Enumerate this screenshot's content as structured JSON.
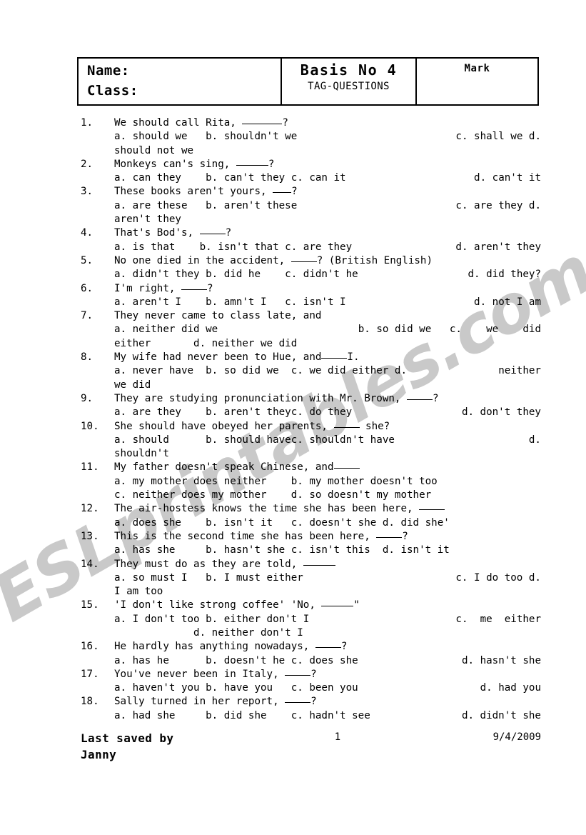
{
  "header": {
    "name_label": "Name:",
    "class_label": "Class:",
    "title": "Basis No 4",
    "subtitle": "TAG-QUESTIONS",
    "mark_label": "Mark"
  },
  "watermark": {
    "text": "ESLprintables.com"
  },
  "questions": [
    {
      "num": "1.",
      "lines": [
        {
          "type": "stem",
          "segments": [
            {
              "t": "text",
              "v": "We should call Rita, "
            },
            {
              "t": "blank",
              "w": "w6"
            },
            {
              "t": "text",
              "v": "?"
            }
          ]
        },
        {
          "type": "options",
          "segments": [
            {
              "t": "text",
              "v": "a. should we   b. shouldn't we"
            },
            {
              "t": "gap"
            },
            {
              "t": "text",
              "v": "c. shall we d."
            }
          ]
        },
        {
          "type": "cont",
          "segments": [
            {
              "t": "text",
              "v": "should not we"
            }
          ]
        }
      ]
    },
    {
      "num": "2.",
      "lines": [
        {
          "type": "stem",
          "segments": [
            {
              "t": "text",
              "v": "Monkeys can's sing, "
            },
            {
              "t": "blank",
              "w": "w5"
            },
            {
              "t": "text",
              "v": "?"
            }
          ]
        },
        {
          "type": "options",
          "segments": [
            {
              "t": "text",
              "v": "a. can they    b. can't they c. can it"
            },
            {
              "t": "gap"
            },
            {
              "t": "text",
              "v": "d. can't it"
            }
          ]
        }
      ]
    },
    {
      "num": "3.",
      "lines": [
        {
          "type": "stem",
          "segments": [
            {
              "t": "text",
              "v": "These books aren't yours, "
            },
            {
              "t": "blank",
              "w": "w3"
            },
            {
              "t": "text",
              "v": "?"
            }
          ]
        },
        {
          "type": "options",
          "segments": [
            {
              "t": "text",
              "v": "a. are these   b. aren't these"
            },
            {
              "t": "gap"
            },
            {
              "t": "text",
              "v": "c. are they d."
            }
          ]
        },
        {
          "type": "cont",
          "segments": [
            {
              "t": "text",
              "v": "aren't they"
            }
          ]
        }
      ]
    },
    {
      "num": "4.",
      "lines": [
        {
          "type": "stem",
          "segments": [
            {
              "t": "text",
              "v": "That's Bod's, "
            },
            {
              "t": "blank",
              "w": "w4"
            },
            {
              "t": "text",
              "v": "?"
            }
          ]
        },
        {
          "type": "options",
          "segments": [
            {
              "t": "text",
              "v": "a. is that    b. isn't that c. are they"
            },
            {
              "t": "gap"
            },
            {
              "t": "text",
              "v": "d. aren't they"
            }
          ]
        }
      ]
    },
    {
      "num": "5.",
      "lines": [
        {
          "type": "stem",
          "segments": [
            {
              "t": "text",
              "v": "No one died in the accident, "
            },
            {
              "t": "blank",
              "w": "w4"
            },
            {
              "t": "text",
              "v": "? (British English)"
            }
          ]
        },
        {
          "type": "options",
          "segments": [
            {
              "t": "text",
              "v": "a. didn't they b. did he    c. didn't he"
            },
            {
              "t": "gap"
            },
            {
              "t": "text",
              "v": "d. did they?"
            }
          ]
        }
      ]
    },
    {
      "num": "6.",
      "lines": [
        {
          "type": "stem",
          "segments": [
            {
              "t": "text",
              "v": "I'm right, "
            },
            {
              "t": "blank",
              "w": "w4"
            },
            {
              "t": "text",
              "v": "?"
            }
          ]
        },
        {
          "type": "options",
          "segments": [
            {
              "t": "text",
              "v": "a. aren't I    b. amn't I   c. isn't I"
            },
            {
              "t": "gap"
            },
            {
              "t": "text",
              "v": "d. not I am"
            }
          ]
        }
      ]
    },
    {
      "num": "7.",
      "lines": [
        {
          "type": "stem",
          "segments": [
            {
              "t": "text",
              "v": "They never came to class late, and"
            }
          ]
        },
        {
          "type": "options",
          "segments": [
            {
              "t": "text",
              "v": "a. neither did we"
            },
            {
              "t": "gap"
            },
            {
              "t": "text",
              "v": "b. so did we   c.    we    did"
            }
          ]
        },
        {
          "type": "cont",
          "segments": [
            {
              "t": "text",
              "v": "either       d. neither we did"
            }
          ]
        }
      ]
    },
    {
      "num": "8.",
      "lines": [
        {
          "type": "stem",
          "segments": [
            {
              "t": "text",
              "v": "My wife had never been to Hue, and"
            },
            {
              "t": "blank",
              "w": "w4"
            },
            {
              "t": "text",
              "v": "I."
            }
          ]
        },
        {
          "type": "options",
          "segments": [
            {
              "t": "text",
              "v": "a. never have  b. so did we  c. we did either d."
            },
            {
              "t": "gap"
            },
            {
              "t": "text",
              "v": "neither"
            }
          ]
        },
        {
          "type": "cont",
          "segments": [
            {
              "t": "text",
              "v": "we did"
            }
          ]
        }
      ]
    },
    {
      "num": "9.",
      "lines": [
        {
          "type": "stem",
          "segments": [
            {
              "t": "text",
              "v": "They are studying pronunciation with Mr. Brown, "
            },
            {
              "t": "blank",
              "w": "w4"
            },
            {
              "t": "text",
              "v": "?"
            }
          ]
        },
        {
          "type": "options",
          "segments": [
            {
              "t": "text",
              "v": "a. are they    b. aren't theyc. do they"
            },
            {
              "t": "gap"
            },
            {
              "t": "text",
              "v": "d. don't they"
            }
          ]
        }
      ]
    },
    {
      "num": "10.",
      "lines": [
        {
          "type": "stem",
          "segments": [
            {
              "t": "text",
              "v": "She should have obeyed her parents, "
            },
            {
              "t": "blank",
              "w": "w4"
            },
            {
              "t": "text",
              "v": " she?"
            }
          ]
        },
        {
          "type": "options",
          "segments": [
            {
              "t": "text",
              "v": "a. should      b. should havec. shouldn't have"
            },
            {
              "t": "gap"
            },
            {
              "t": "text",
              "v": "d."
            }
          ]
        },
        {
          "type": "cont",
          "segments": [
            {
              "t": "text",
              "v": "shouldn't"
            }
          ]
        }
      ]
    },
    {
      "num": "11.",
      "lines": [
        {
          "type": "stem",
          "segments": [
            {
              "t": "text",
              "v": "My father doesn't speak Chinese, and"
            },
            {
              "t": "blank",
              "w": "w4"
            }
          ]
        },
        {
          "type": "cont",
          "segments": [
            {
              "t": "text",
              "v": "a. my mother does neither    b. my mother doesn't too"
            }
          ]
        },
        {
          "type": "cont",
          "segments": [
            {
              "t": "text",
              "v": "c. neither does my mother    d. so doesn't my mother"
            }
          ]
        }
      ]
    },
    {
      "num": "12.",
      "lines": [
        {
          "type": "stem",
          "segments": [
            {
              "t": "text",
              "v": "The air-hostess knows the time she has been here, "
            },
            {
              "t": "blank",
              "w": "w4"
            }
          ]
        },
        {
          "type": "cont",
          "segments": [
            {
              "t": "text",
              "v": "a. does she    b. isn't it   c. doesn't she d. did she'"
            }
          ]
        }
      ]
    },
    {
      "num": "13.",
      "lines": [
        {
          "type": "stem",
          "segments": [
            {
              "t": "text",
              "v": "This is the second time she has been here, "
            },
            {
              "t": "blank",
              "w": "w4"
            },
            {
              "t": "text",
              "v": "?"
            }
          ]
        },
        {
          "type": "cont",
          "segments": [
            {
              "t": "text",
              "v": "a. has she     b. hasn't she c. isn't this  d. isn't it"
            }
          ]
        }
      ]
    },
    {
      "num": "14.",
      "lines": [
        {
          "type": "stem",
          "segments": [
            {
              "t": "text",
              "v": "They must do as they are told, "
            },
            {
              "t": "blank",
              "w": "w5"
            }
          ]
        },
        {
          "type": "options",
          "segments": [
            {
              "t": "text",
              "v": "a. so must I   b. I must either"
            },
            {
              "t": "gap"
            },
            {
              "t": "text",
              "v": "c. I do too d."
            }
          ]
        },
        {
          "type": "cont",
          "segments": [
            {
              "t": "text",
              "v": "I am too"
            }
          ]
        }
      ]
    },
    {
      "num": "15.",
      "lines": [
        {
          "type": "stem",
          "segments": [
            {
              "t": "text",
              "v": "'I don't like strong coffee' 'No, "
            },
            {
              "t": "blank",
              "w": "w5"
            },
            {
              "t": "text",
              "v": "\""
            }
          ]
        },
        {
          "type": "options",
          "segments": [
            {
              "t": "text",
              "v": "a. I don't too b. either don't I"
            },
            {
              "t": "gap"
            },
            {
              "t": "text",
              "v": "c.  me  either"
            }
          ]
        },
        {
          "type": "cont",
          "segments": [
            {
              "t": "text",
              "v": "             d. neither don't I"
            }
          ]
        }
      ]
    },
    {
      "num": "16.",
      "lines": [
        {
          "type": "stem",
          "segments": [
            {
              "t": "text",
              "v": "He hardly has anything nowadays, "
            },
            {
              "t": "blank",
              "w": "w4"
            },
            {
              "t": "text",
              "v": "?"
            }
          ]
        },
        {
          "type": "options",
          "segments": [
            {
              "t": "text",
              "v": "a. has he      b. doesn't he c. does she"
            },
            {
              "t": "gap"
            },
            {
              "t": "text",
              "v": "d. hasn't she"
            }
          ]
        }
      ]
    },
    {
      "num": "17.",
      "lines": [
        {
          "type": "stem",
          "segments": [
            {
              "t": "text",
              "v": "You've never been in Italy, "
            },
            {
              "t": "blank",
              "w": "w4"
            },
            {
              "t": "text",
              "v": "?"
            }
          ]
        },
        {
          "type": "options",
          "segments": [
            {
              "t": "text",
              "v": "a. haven't you b. have you   c. been you"
            },
            {
              "t": "gap"
            },
            {
              "t": "text",
              "v": "d. had you"
            }
          ]
        }
      ]
    },
    {
      "num": "18.",
      "lines": [
        {
          "type": "stem",
          "segments": [
            {
              "t": "text",
              "v": "Sally turned in her report, "
            },
            {
              "t": "blank",
              "w": "w4"
            },
            {
              "t": "text",
              "v": "?"
            }
          ]
        },
        {
          "type": "options",
          "segments": [
            {
              "t": "text",
              "v": "a. had she     b. did she    c. hadn't see"
            },
            {
              "t": "gap"
            },
            {
              "t": "text",
              "v": "d. didn't she"
            }
          ]
        }
      ]
    }
  ],
  "footer": {
    "saved_by": "Last saved by",
    "author": "Janny",
    "page_number": "1",
    "date": "9/4/2009"
  }
}
